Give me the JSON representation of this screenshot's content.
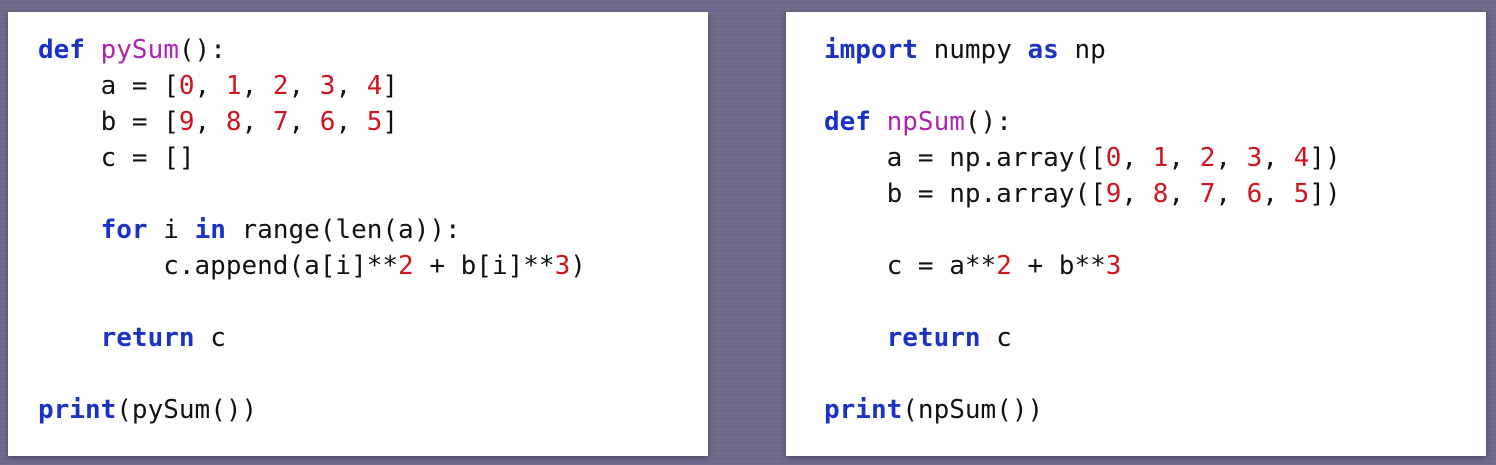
{
  "colors": {
    "background": "#6e6a8c",
    "panel": "#ffffff",
    "keyword": "#1a32c8",
    "function_name": "#b024b4",
    "number": "#d0141e",
    "text": "#111111"
  },
  "left_panel": {
    "lines": [
      [
        {
          "t": "kw",
          "v": "def"
        },
        {
          "t": "pl",
          "v": " "
        },
        {
          "t": "fn",
          "v": "pySum"
        },
        {
          "t": "pl",
          "v": "():"
        }
      ],
      [
        {
          "t": "pl",
          "v": "    a = ["
        },
        {
          "t": "num",
          "v": "0"
        },
        {
          "t": "pl",
          "v": ", "
        },
        {
          "t": "num",
          "v": "1"
        },
        {
          "t": "pl",
          "v": ", "
        },
        {
          "t": "num",
          "v": "2"
        },
        {
          "t": "pl",
          "v": ", "
        },
        {
          "t": "num",
          "v": "3"
        },
        {
          "t": "pl",
          "v": ", "
        },
        {
          "t": "num",
          "v": "4"
        },
        {
          "t": "pl",
          "v": "]"
        }
      ],
      [
        {
          "t": "pl",
          "v": "    b = ["
        },
        {
          "t": "num",
          "v": "9"
        },
        {
          "t": "pl",
          "v": ", "
        },
        {
          "t": "num",
          "v": "8"
        },
        {
          "t": "pl",
          "v": ", "
        },
        {
          "t": "num",
          "v": "7"
        },
        {
          "t": "pl",
          "v": ", "
        },
        {
          "t": "num",
          "v": "6"
        },
        {
          "t": "pl",
          "v": ", "
        },
        {
          "t": "num",
          "v": "5"
        },
        {
          "t": "pl",
          "v": "]"
        }
      ],
      [
        {
          "t": "pl",
          "v": "    c = []"
        }
      ],
      [],
      [
        {
          "t": "pl",
          "v": "    "
        },
        {
          "t": "kw",
          "v": "for"
        },
        {
          "t": "pl",
          "v": " i "
        },
        {
          "t": "kw",
          "v": "in"
        },
        {
          "t": "pl",
          "v": " range(len(a)):"
        }
      ],
      [
        {
          "t": "pl",
          "v": "        c.append(a[i]**"
        },
        {
          "t": "num",
          "v": "2"
        },
        {
          "t": "pl",
          "v": " + b[i]**"
        },
        {
          "t": "num",
          "v": "3"
        },
        {
          "t": "pl",
          "v": ")"
        }
      ],
      [],
      [
        {
          "t": "pl",
          "v": "    "
        },
        {
          "t": "kw",
          "v": "return"
        },
        {
          "t": "pl",
          "v": " c"
        }
      ],
      [],
      [
        {
          "t": "kw",
          "v": "print"
        },
        {
          "t": "pl",
          "v": "(pySum())"
        }
      ]
    ]
  },
  "right_panel": {
    "lines": [
      [
        {
          "t": "kw",
          "v": "import"
        },
        {
          "t": "pl",
          "v": " numpy "
        },
        {
          "t": "kw",
          "v": "as"
        },
        {
          "t": "pl",
          "v": " np"
        }
      ],
      [],
      [
        {
          "t": "kw",
          "v": "def"
        },
        {
          "t": "pl",
          "v": " "
        },
        {
          "t": "fn",
          "v": "npSum"
        },
        {
          "t": "pl",
          "v": "():"
        }
      ],
      [
        {
          "t": "pl",
          "v": "    a = np.array(["
        },
        {
          "t": "num",
          "v": "0"
        },
        {
          "t": "pl",
          "v": ", "
        },
        {
          "t": "num",
          "v": "1"
        },
        {
          "t": "pl",
          "v": ", "
        },
        {
          "t": "num",
          "v": "2"
        },
        {
          "t": "pl",
          "v": ", "
        },
        {
          "t": "num",
          "v": "3"
        },
        {
          "t": "pl",
          "v": ", "
        },
        {
          "t": "num",
          "v": "4"
        },
        {
          "t": "pl",
          "v": "])"
        }
      ],
      [
        {
          "t": "pl",
          "v": "    b = np.array(["
        },
        {
          "t": "num",
          "v": "9"
        },
        {
          "t": "pl",
          "v": ", "
        },
        {
          "t": "num",
          "v": "8"
        },
        {
          "t": "pl",
          "v": ", "
        },
        {
          "t": "num",
          "v": "7"
        },
        {
          "t": "pl",
          "v": ", "
        },
        {
          "t": "num",
          "v": "6"
        },
        {
          "t": "pl",
          "v": ", "
        },
        {
          "t": "num",
          "v": "5"
        },
        {
          "t": "pl",
          "v": "])"
        }
      ],
      [],
      [
        {
          "t": "pl",
          "v": "    c = a**"
        },
        {
          "t": "num",
          "v": "2"
        },
        {
          "t": "pl",
          "v": " + b**"
        },
        {
          "t": "num",
          "v": "3"
        }
      ],
      [],
      [
        {
          "t": "pl",
          "v": "    "
        },
        {
          "t": "kw",
          "v": "return"
        },
        {
          "t": "pl",
          "v": " c"
        }
      ],
      [],
      [
        {
          "t": "kw",
          "v": "print"
        },
        {
          "t": "pl",
          "v": "(npSum())"
        }
      ]
    ]
  }
}
